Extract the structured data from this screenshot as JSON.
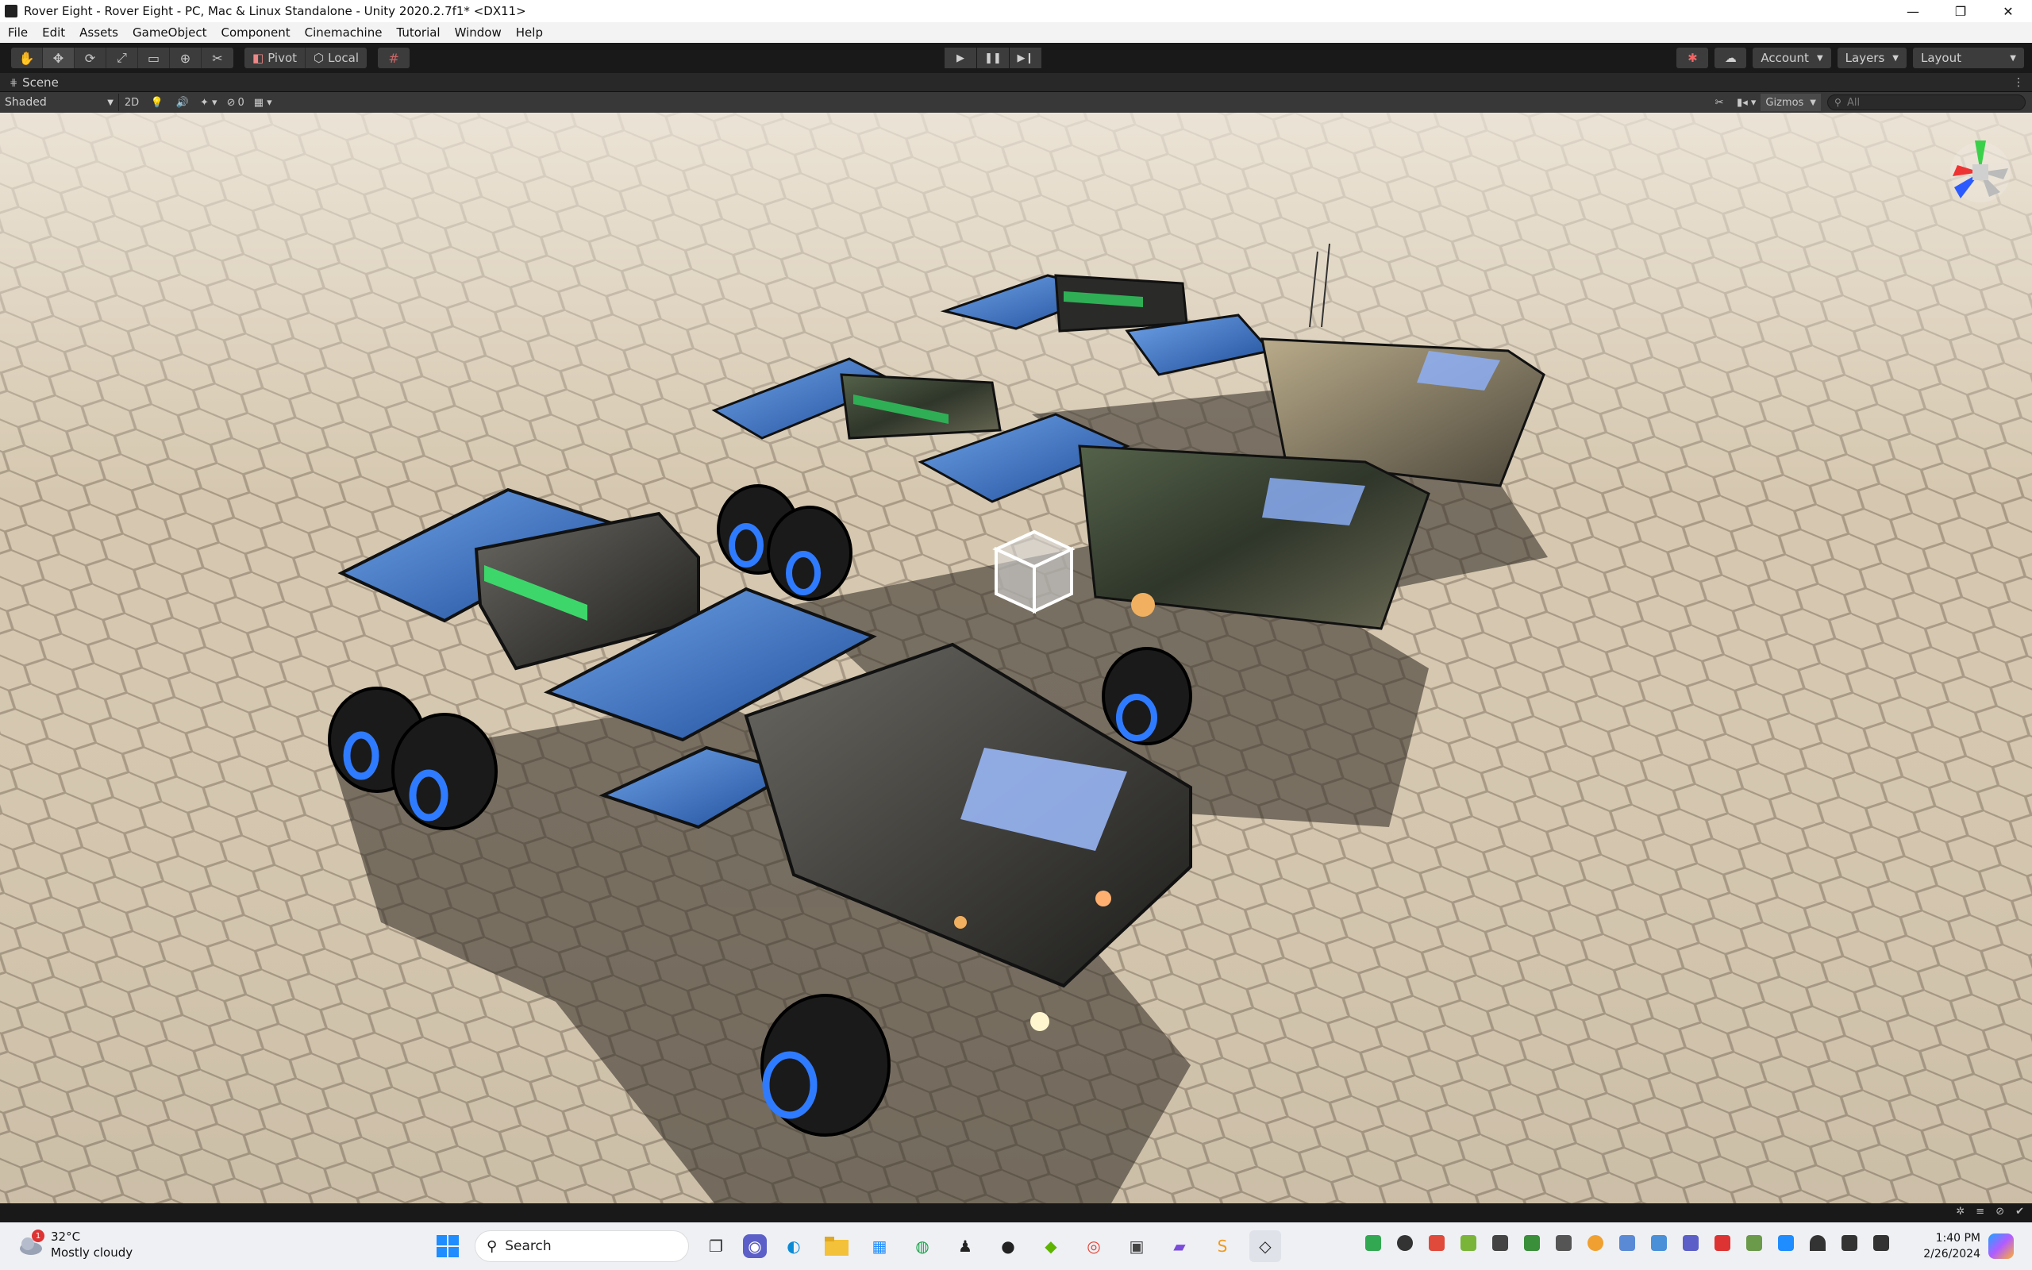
{
  "window": {
    "title": "Rover Eight - Rover Eight - PC, Mac & Linux Standalone - Unity 2020.2.7f1* <DX11>",
    "minimize": "—",
    "maximize": "❐",
    "close": "✕"
  },
  "menu": [
    "File",
    "Edit",
    "Assets",
    "GameObject",
    "Component",
    "Cinemachine",
    "Tutorial",
    "Window",
    "Help"
  ],
  "toolbar": {
    "pivot_label": "Pivot",
    "local_label": "Local",
    "account_label": "Account",
    "layers_label": "Layers",
    "layout_label": "Layout"
  },
  "scene": {
    "tab_label": "Scene",
    "draw_mode": "Shaded",
    "mode_2d": "2D",
    "hidden_count": "0",
    "gizmos_label": "Gizmos",
    "search_placeholder": "All"
  },
  "taskbar": {
    "weather_temp": "32°C",
    "weather_desc": "Mostly cloudy",
    "weather_badge": "1",
    "search_label": "Search",
    "time": "1:40 PM",
    "date": "2/26/2024"
  },
  "colors": {
    "editor_bg": "#191919",
    "accent_blue": "#2f7bff",
    "sand": "#d9cbb3"
  }
}
